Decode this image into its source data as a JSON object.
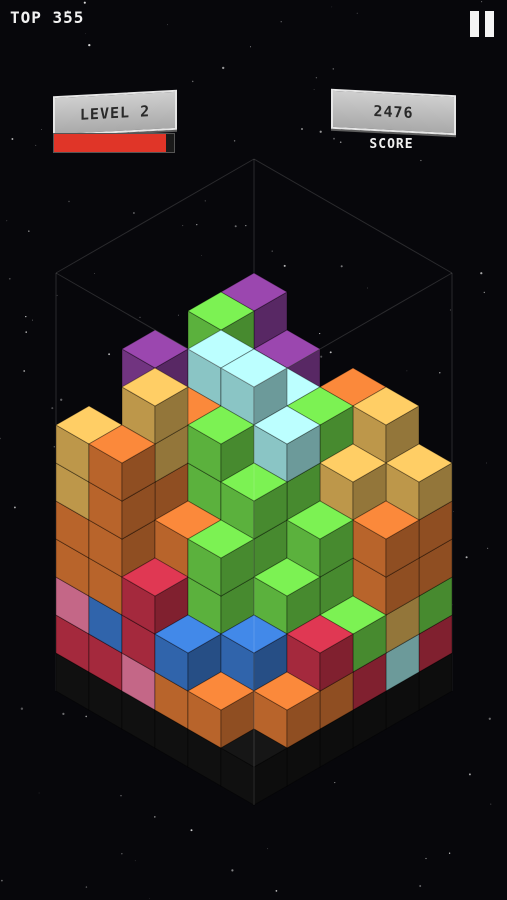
{
  "hud": {
    "top_score": "TOP 355",
    "level_label": "LEVEL 2",
    "level_progress": 0.93,
    "score_value": "2476",
    "score_caption": "SCORE"
  },
  "icons": {
    "pause": "pause-icon"
  },
  "colors": {
    "background": "#07070b",
    "level_bar": "#e03528",
    "purple": "#8a3f9c",
    "green": "#6fd84a",
    "orange": "#e07a35",
    "yellow": "#e6b85a",
    "cyan": "#a8f0f0",
    "red": "#c8324a",
    "blue": "#3b7ad0",
    "pink": "#ef7ea5",
    "dark": "#141414"
  }
}
